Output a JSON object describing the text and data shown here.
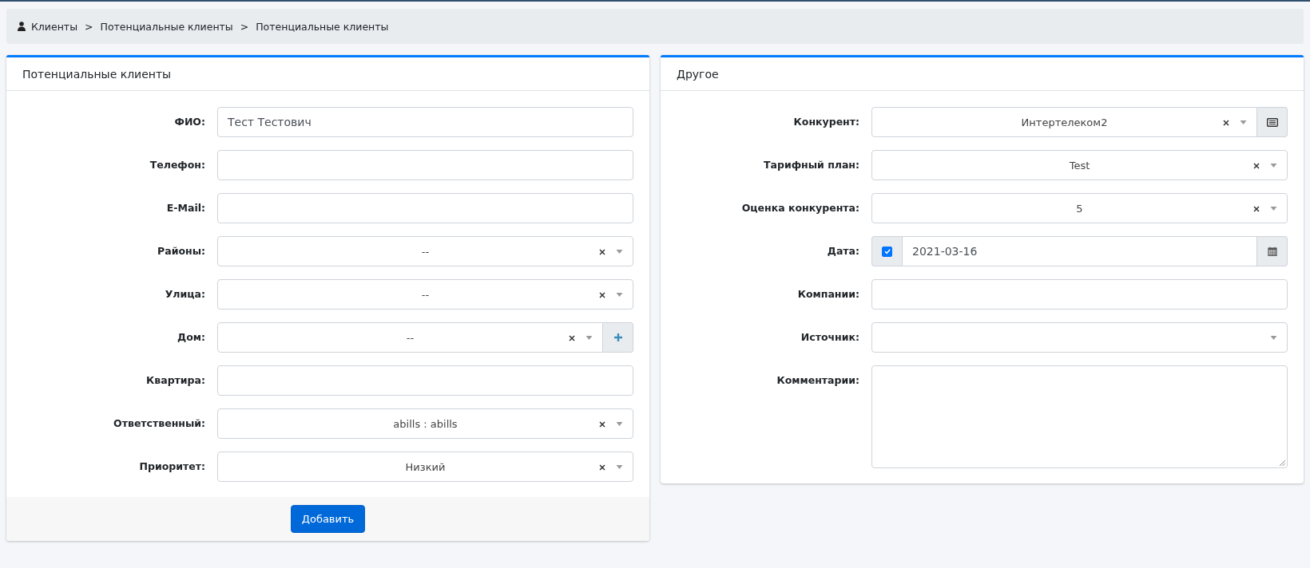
{
  "breadcrumb": [
    "Клиенты",
    "Потенциальные клиенты",
    "Потенциальные клиенты"
  ],
  "breadcrumb_separator": ">",
  "cards": [
    {
      "title": "Потенциальные клиенты",
      "fields": [
        {
          "label": "ФИО:",
          "kind": "text",
          "value": "Тест Тестович"
        },
        {
          "label": "Телефон:",
          "kind": "text"
        },
        {
          "label": "E-Mail:",
          "kind": "text"
        },
        {
          "label": "Районы:",
          "kind": "select",
          "value": "--",
          "clearable": true
        },
        {
          "label": "Улица:",
          "kind": "select",
          "value": "--",
          "clearable": true
        },
        {
          "label": "Дом:",
          "kind": "select_add",
          "value": "--",
          "clearable": true
        },
        {
          "label": "Квартира:",
          "kind": "text"
        },
        {
          "label": "Ответственный:",
          "kind": "select",
          "value": "abills : abills",
          "clearable": true
        },
        {
          "label": "Приоритет:",
          "kind": "select",
          "value": "Низкий",
          "clearable": true
        }
      ],
      "submit": "Добавить"
    },
    {
      "title": "Другое",
      "fields": [
        {
          "label": "Конкурент:",
          "kind": "select_list",
          "value": "Интертелеком2",
          "clearable": true
        },
        {
          "label": "Тарифный план:",
          "kind": "select",
          "value": "Test",
          "clearable": true
        },
        {
          "label": "Оценка конкурента:",
          "kind": "select",
          "value": "5",
          "clearable": true
        },
        {
          "label": "Дата:",
          "kind": "date",
          "value": "2021-03-16",
          "checked": true
        },
        {
          "label": "Компании:",
          "kind": "text"
        },
        {
          "label": "Источник:",
          "kind": "select",
          "clearable": false
        },
        {
          "label": "Комментарии:",
          "kind": "textarea"
        }
      ]
    }
  ]
}
